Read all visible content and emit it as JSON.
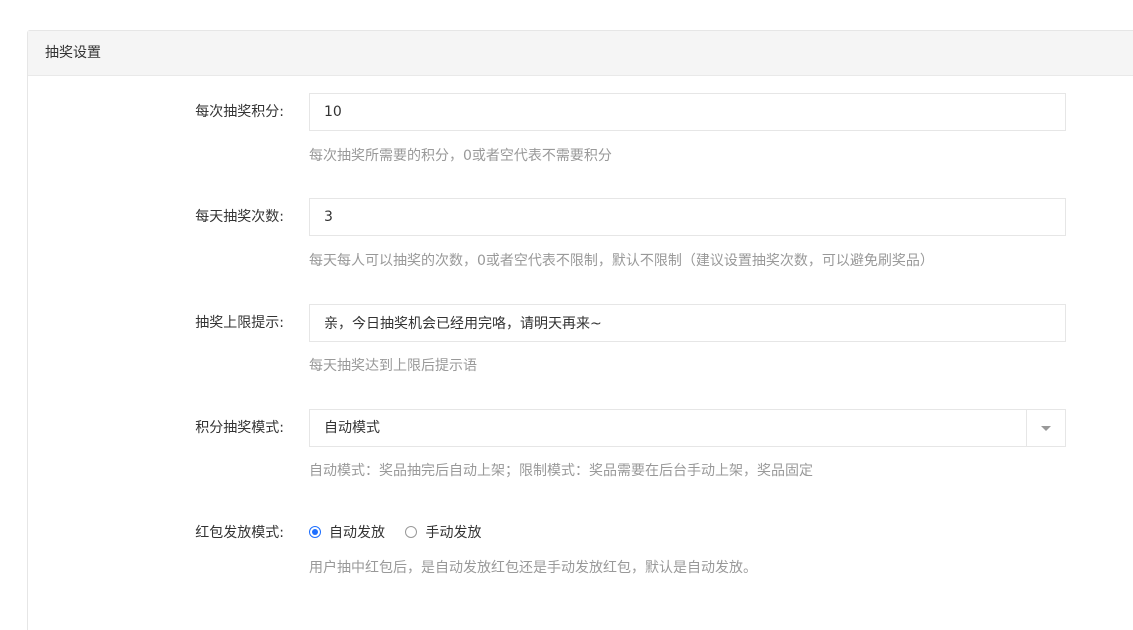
{
  "panel": {
    "title": "抽奖设置"
  },
  "fields": {
    "points_per_draw": {
      "label": "每次抽奖积分:",
      "value": "10",
      "help": "每次抽奖所需要的积分，0或者空代表不需要积分"
    },
    "draws_per_day": {
      "label": "每天抽奖次数:",
      "value": "3",
      "help": "每天每人可以抽奖的次数，0或者空代表不限制，默认不限制（建议设置抽奖次数，可以避免刷奖品）"
    },
    "limit_message": {
      "label": "抽奖上限提示:",
      "value": "亲，今日抽奖机会已经用完咯，请明天再来~",
      "help": "每天抽奖达到上限后提示语"
    },
    "points_mode": {
      "label": "积分抽奖模式:",
      "selected": "自动模式",
      "help": "自动模式：奖品抽完后自动上架；限制模式：奖品需要在后台手动上架，奖品固定"
    },
    "redpacket_mode": {
      "label": "红包发放模式:",
      "options": [
        {
          "label": "自动发放",
          "checked": true
        },
        {
          "label": "手动发放",
          "checked": false
        }
      ],
      "help": "用户抽中红包后，是自动发放红包还是手动发放红包，默认是自动发放。"
    }
  },
  "colors": {
    "radio_checked": "#1e6fff",
    "help_text": "#999999",
    "border": "#e6e6e6"
  }
}
